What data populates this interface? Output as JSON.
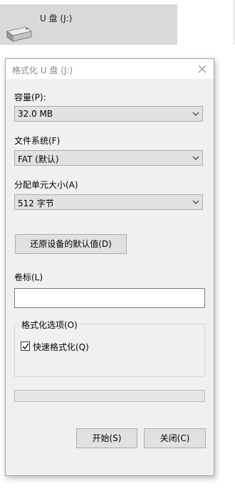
{
  "drive": {
    "name": "U 盘 (J:)",
    "icon": "usb-drive-icon"
  },
  "dialog": {
    "title": "格式化 U 盘 (J:)",
    "close_icon": "close-icon",
    "capacity": {
      "label": "容量(P):",
      "value": "32.0 MB"
    },
    "file_system": {
      "label": "文件系统(F)",
      "value": "FAT (默认)"
    },
    "allocation_unit": {
      "label": "分配单元大小(A)",
      "value": "512 字节"
    },
    "restore_defaults_label": "还原设备的默认值(D)",
    "volume_label": {
      "label": "卷标(L)",
      "value": ""
    },
    "format_options": {
      "legend": "格式化选项(O)",
      "quick_format": {
        "label": "快速格式化(Q)",
        "checked": true
      }
    },
    "progress": {
      "value": 0
    },
    "start_label": "开始(S)",
    "close_label": "关闭(C)"
  }
}
